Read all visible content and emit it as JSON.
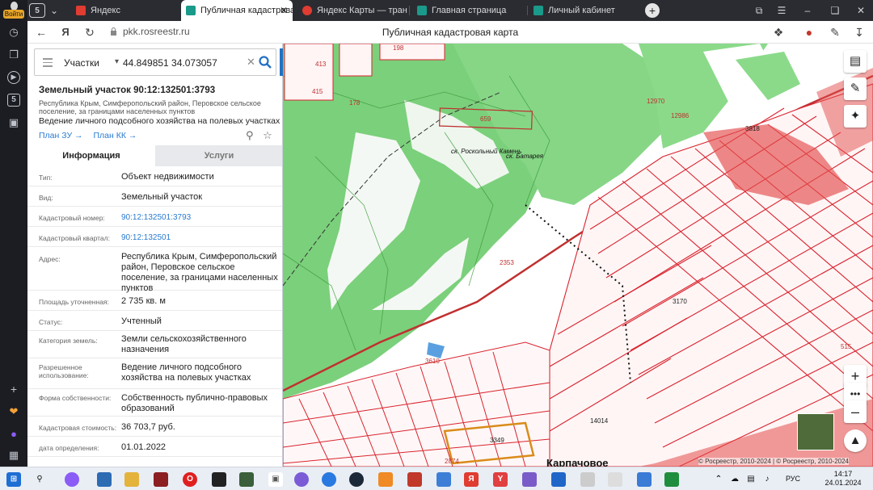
{
  "browser": {
    "profile_label": "Войти",
    "tab_count": "5",
    "tabs": [
      {
        "title": "Яндекс",
        "active": false,
        "color": "#e03c31"
      },
      {
        "title": "Публичная кадастровая к",
        "active": true,
        "color": "#1a9a8a"
      },
      {
        "title": "Яндекс Карты — транспор",
        "active": false,
        "color": "#e03c31"
      },
      {
        "title": "Главная страница",
        "active": false,
        "color": "#1a9a8a"
      },
      {
        "title": "Личный кабинет",
        "active": false,
        "color": "#1a9a8a"
      }
    ],
    "address": "pkk.rosreestr.ru",
    "page_title": "Публичная кадастровая карта"
  },
  "search": {
    "category": "Участки",
    "query": "44.849851 34.073057"
  },
  "parcel": {
    "title": "Земельный участок 90:12:132501:3793",
    "address_short": "Республика Крым, Симферопольский район, Перовское сельское поселение, за границами населенных пунктов",
    "description": "Ведение личного подсобного хозяйства на полевых участках",
    "plan_zu": "План ЗУ",
    "plan_kk": "План КК"
  },
  "tabs": {
    "info": "Информация",
    "services": "Услуги"
  },
  "info_rows": [
    {
      "key": "Тип:",
      "value": "Объект недвижимости",
      "link": false
    },
    {
      "key": "Вид:",
      "value": "Земельный участок",
      "link": false
    },
    {
      "key": "Кадастровый номер:",
      "value": "90:12:132501:3793",
      "link": true
    },
    {
      "key": "Кадастровый квартал:",
      "value": "90:12:132501",
      "link": true
    },
    {
      "key": "Адрес:",
      "value": "Республика Крым, Симферопольский район, Перовское сельское поселение, за границами населенных пунктов",
      "link": false
    },
    {
      "key": "Площадь уточненная:",
      "value": "2 735 кв. м",
      "link": false
    },
    {
      "key": "Статус:",
      "value": "Учтенный",
      "link": false
    },
    {
      "key": "Категория земель:",
      "value": "Земли сельскохозяйственного назначения",
      "link": false
    },
    {
      "key": "Разрешенное использование:",
      "value": "Ведение личного подсобного хозяйства на полевых участках",
      "link": false
    },
    {
      "key": "Форма собственности:",
      "value": "Собственность публично-правовых образований",
      "link": false
    },
    {
      "key": "Кадастровая стоимость:",
      "value": "36 703,7 руб.",
      "link": false
    },
    {
      "key": "дата определения:",
      "value": "01.01.2022",
      "link": false
    }
  ],
  "map": {
    "labels": [
      "413",
      "198",
      "415",
      "178",
      "12970",
      "659",
      "3818",
      "ск. Роскольный Камень",
      "ск. Батарея",
      "3170",
      "2353",
      "3349",
      "2874",
      "3610",
      "14014",
      "515",
      "12986",
      "Карпачовое"
    ],
    "attribution": "© Росреестр, 2010-2024 | © Росреестр, 2010-2024"
  },
  "taskbar": {
    "lang": "РУС",
    "time": "14:17",
    "date": "24.01.2024"
  },
  "colors": {
    "accent": "#2270c3",
    "link": "#2a7bd0",
    "map_green": "#7bd07b",
    "parcel_red": "#d9232e"
  }
}
